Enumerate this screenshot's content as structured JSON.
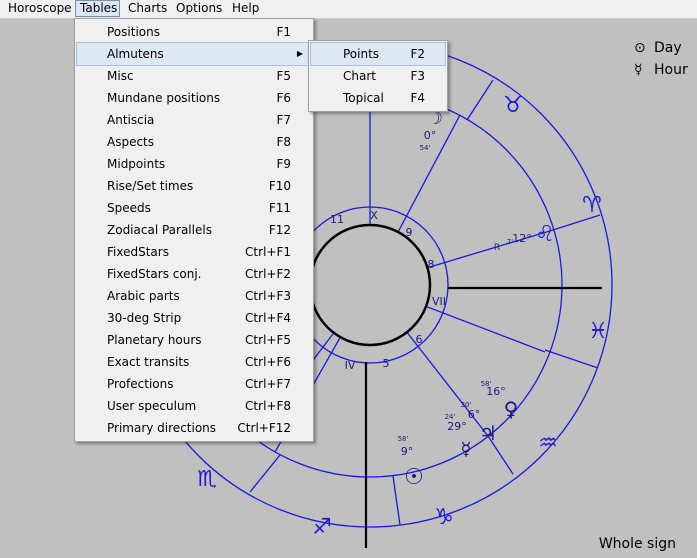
{
  "menubar": {
    "items": [
      "Horoscope",
      "Tables",
      "Charts",
      "Options",
      "Help"
    ],
    "active": "Tables"
  },
  "tables_menu": [
    {
      "label": "Positions",
      "shortcut": "F1"
    },
    {
      "label": "Almutens",
      "shortcut": "",
      "submenu": true,
      "highlighted": true
    },
    {
      "label": "Misc",
      "shortcut": "F5"
    },
    {
      "label": "Mundane positions",
      "shortcut": "F6"
    },
    {
      "label": "Antiscia",
      "shortcut": "F7"
    },
    {
      "label": "Aspects",
      "shortcut": "F8"
    },
    {
      "label": "Midpoints",
      "shortcut": "F9"
    },
    {
      "label": "Rise/Set times",
      "shortcut": "F10"
    },
    {
      "label": "Speeds",
      "shortcut": "F11"
    },
    {
      "label": "Zodiacal Parallels",
      "shortcut": "F12"
    },
    {
      "label": "FixedStars",
      "shortcut": "Ctrl+F1"
    },
    {
      "label": "FixedStars conj.",
      "shortcut": "Ctrl+F2"
    },
    {
      "label": "Arabic parts",
      "shortcut": "Ctrl+F3"
    },
    {
      "label": "30-deg Strip",
      "shortcut": "Ctrl+F4"
    },
    {
      "label": "Planetary hours",
      "shortcut": "Ctrl+F5"
    },
    {
      "label": "Exact transits",
      "shortcut": "Ctrl+F6"
    },
    {
      "label": "Profections",
      "shortcut": "Ctrl+F7"
    },
    {
      "label": "User speculum",
      "shortcut": "Ctrl+F8"
    },
    {
      "label": "Primary directions",
      "shortcut": "Ctrl+F12"
    }
  ],
  "almutens_submenu": [
    {
      "label": "Points",
      "shortcut": "F2",
      "highlighted": true
    },
    {
      "label": "Chart",
      "shortcut": "F3"
    },
    {
      "label": "Topical",
      "shortcut": "F4"
    }
  ],
  "legend": {
    "day": {
      "symbol": "⊙",
      "label": "Day"
    },
    "hour": {
      "symbol": "☿",
      "label": "Hour"
    }
  },
  "footer": "Whole sign",
  "chart": {
    "colors": {
      "wheel": "#1a1adc",
      "axes": "#000000",
      "background": "#c0c0c0",
      "text": "#1a1a80"
    },
    "sign_glyphs": [
      "♉",
      "♈",
      "♌",
      "♓",
      "♒",
      "♑",
      "♐",
      "♏"
    ],
    "house_labels": [
      "11",
      "X",
      "9",
      "8",
      "VII",
      "6",
      "5",
      "IV"
    ],
    "planet_glyphs": [
      "♀",
      "♃",
      "☿",
      "☉",
      "☽"
    ],
    "planet_degrees": [
      "16°",
      "6°",
      "29°",
      "9°",
      "12°",
      "0°"
    ],
    "planet_minutes": [
      "58'",
      "30'",
      "24'",
      "58'",
      "7'",
      "54'"
    ],
    "retro_label": "R"
  }
}
